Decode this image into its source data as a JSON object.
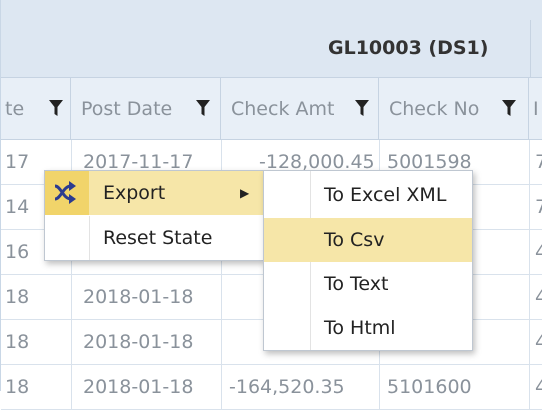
{
  "grid": {
    "group_title": "GL10003 (DS1)",
    "columns": [
      {
        "id": "date",
        "label": "te"
      },
      {
        "id": "post_date",
        "label": "Post Date"
      },
      {
        "id": "check_amt",
        "label": "Check Amt"
      },
      {
        "id": "check_no",
        "label": "Check No"
      },
      {
        "id": "next",
        "label": "I"
      }
    ],
    "rows": [
      {
        "date": "17",
        "post_date": "2017-11-17",
        "check_amt": "-128,000.45",
        "check_no": "5001598",
        "next": "7"
      },
      {
        "date": "14",
        "post_date": "",
        "check_amt": "",
        "check_no": "",
        "next": "7"
      },
      {
        "date": "16",
        "post_date": "",
        "check_amt": "",
        "check_no": "",
        "next": "4"
      },
      {
        "date": "18",
        "post_date": "2018-01-18",
        "check_amt": "",
        "check_no": "",
        "next": "4"
      },
      {
        "date": "18",
        "post_date": "2018-01-18",
        "check_amt": "",
        "check_no": "",
        "next": "4"
      },
      {
        "date": "18",
        "post_date": "2018-01-18",
        "check_amt": "-164,520.35",
        "check_no": "5101600",
        "next": "4"
      }
    ]
  },
  "context_menu": {
    "items": [
      {
        "label": "Export",
        "icon": "export-icon",
        "has_submenu": true,
        "highlighted": true
      },
      {
        "label": "Reset State",
        "icon": "",
        "has_submenu": false,
        "highlighted": false
      }
    ],
    "submenu": {
      "items": [
        {
          "label": "To Excel XML",
          "highlighted": false
        },
        {
          "label": "To Csv",
          "highlighted": true
        },
        {
          "label": "To Text",
          "highlighted": false
        },
        {
          "label": "To Html",
          "highlighted": false
        }
      ]
    }
  },
  "colors": {
    "highlight": "#f6e6a8",
    "highlight_icon": "#f1d46a",
    "header_bg": "#e8eff7",
    "banner_bg": "#dde7f2"
  }
}
